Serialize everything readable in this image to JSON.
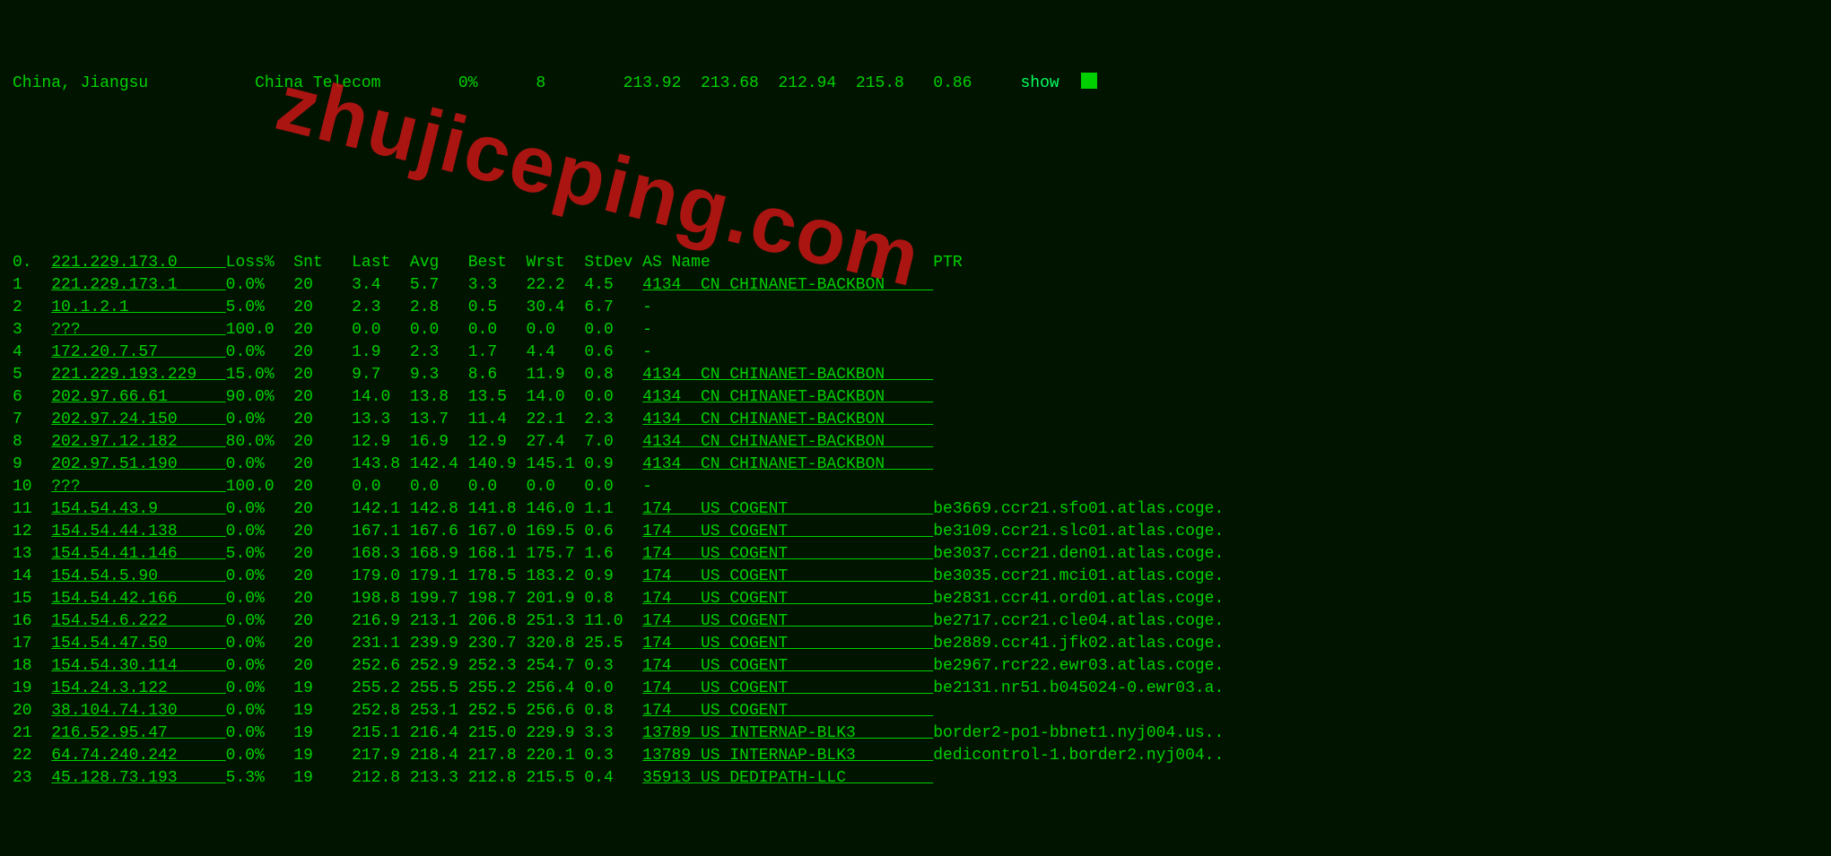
{
  "header": {
    "location": "China, Jiangsu",
    "isp": "China Telecom",
    "loss": "0%",
    "snt": "8",
    "v1": "213.92",
    "v2": "213.68",
    "v3": "212.94",
    "v4": "215.8",
    "v5": "0.86",
    "show": "show"
  },
  "columns": {
    "idx": "0.",
    "host": "221.229.173.0",
    "loss": "Loss%",
    "snt": "Snt",
    "last": "Last",
    "avg": "Avg",
    "best": "Best",
    "wrst": "Wrst",
    "stdev": "StDev",
    "asname": "AS Name",
    "ptr": "PTR"
  },
  "hops": [
    {
      "n": "1",
      "host": "221.229.173.1",
      "loss": "0.0%",
      "snt": "20",
      "last": "3.4",
      "avg": "5.7",
      "best": "3.3",
      "wrst": "22.2",
      "stdev": "4.5",
      "asn": "4134",
      "cc": "CN",
      "asname": "CHINANET-BACKBON",
      "ptr": ""
    },
    {
      "n": "2",
      "host": "10.1.2.1",
      "loss": "5.0%",
      "snt": "20",
      "last": "2.3",
      "avg": "2.8",
      "best": "0.5",
      "wrst": "30.4",
      "stdev": "6.7",
      "asn": "-",
      "cc": "",
      "asname": "",
      "ptr": ""
    },
    {
      "n": "3",
      "host": "???",
      "loss": "100.0",
      "snt": "20",
      "last": "0.0",
      "avg": "0.0",
      "best": "0.0",
      "wrst": "0.0",
      "stdev": "0.0",
      "asn": "-",
      "cc": "",
      "asname": "",
      "ptr": ""
    },
    {
      "n": "4",
      "host": "172.20.7.57",
      "loss": "0.0%",
      "snt": "20",
      "last": "1.9",
      "avg": "2.3",
      "best": "1.7",
      "wrst": "4.4",
      "stdev": "0.6",
      "asn": "-",
      "cc": "",
      "asname": "",
      "ptr": ""
    },
    {
      "n": "5",
      "host": "221.229.193.229",
      "loss": "15.0%",
      "snt": "20",
      "last": "9.7",
      "avg": "9.3",
      "best": "8.6",
      "wrst": "11.9",
      "stdev": "0.8",
      "asn": "4134",
      "cc": "CN",
      "asname": "CHINANET-BACKBON",
      "ptr": ""
    },
    {
      "n": "6",
      "host": "202.97.66.61",
      "loss": "90.0%",
      "snt": "20",
      "last": "14.0",
      "avg": "13.8",
      "best": "13.5",
      "wrst": "14.0",
      "stdev": "0.0",
      "asn": "4134",
      "cc": "CN",
      "asname": "CHINANET-BACKBON",
      "ptr": ""
    },
    {
      "n": "7",
      "host": "202.97.24.150",
      "loss": "0.0%",
      "snt": "20",
      "last": "13.3",
      "avg": "13.7",
      "best": "11.4",
      "wrst": "22.1",
      "stdev": "2.3",
      "asn": "4134",
      "cc": "CN",
      "asname": "CHINANET-BACKBON",
      "ptr": ""
    },
    {
      "n": "8",
      "host": "202.97.12.182",
      "loss": "80.0%",
      "snt": "20",
      "last": "12.9",
      "avg": "16.9",
      "best": "12.9",
      "wrst": "27.4",
      "stdev": "7.0",
      "asn": "4134",
      "cc": "CN",
      "asname": "CHINANET-BACKBON",
      "ptr": ""
    },
    {
      "n": "9",
      "host": "202.97.51.190",
      "loss": "0.0%",
      "snt": "20",
      "last": "143.8",
      "avg": "142.4",
      "best": "140.9",
      "wrst": "145.1",
      "stdev": "0.9",
      "asn": "4134",
      "cc": "CN",
      "asname": "CHINANET-BACKBON",
      "ptr": ""
    },
    {
      "n": "10",
      "host": "???",
      "loss": "100.0",
      "snt": "20",
      "last": "0.0",
      "avg": "0.0",
      "best": "0.0",
      "wrst": "0.0",
      "stdev": "0.0",
      "asn": "-",
      "cc": "",
      "asname": "",
      "ptr": ""
    },
    {
      "n": "11",
      "host": "154.54.43.9",
      "loss": "0.0%",
      "snt": "20",
      "last": "142.1",
      "avg": "142.8",
      "best": "141.8",
      "wrst": "146.0",
      "stdev": "1.1",
      "asn": "174",
      "cc": "US",
      "asname": "COGENT",
      "ptr": "be3669.ccr21.sfo01.atlas.coge."
    },
    {
      "n": "12",
      "host": "154.54.44.138",
      "loss": "0.0%",
      "snt": "20",
      "last": "167.1",
      "avg": "167.6",
      "best": "167.0",
      "wrst": "169.5",
      "stdev": "0.6",
      "asn": "174",
      "cc": "US",
      "asname": "COGENT",
      "ptr": "be3109.ccr21.slc01.atlas.coge."
    },
    {
      "n": "13",
      "host": "154.54.41.146",
      "loss": "5.0%",
      "snt": "20",
      "last": "168.3",
      "avg": "168.9",
      "best": "168.1",
      "wrst": "175.7",
      "stdev": "1.6",
      "asn": "174",
      "cc": "US",
      "asname": "COGENT",
      "ptr": "be3037.ccr21.den01.atlas.coge."
    },
    {
      "n": "14",
      "host": "154.54.5.90",
      "loss": "0.0%",
      "snt": "20",
      "last": "179.0",
      "avg": "179.1",
      "best": "178.5",
      "wrst": "183.2",
      "stdev": "0.9",
      "asn": "174",
      "cc": "US",
      "asname": "COGENT",
      "ptr": "be3035.ccr21.mci01.atlas.coge."
    },
    {
      "n": "15",
      "host": "154.54.42.166",
      "loss": "0.0%",
      "snt": "20",
      "last": "198.8",
      "avg": "199.7",
      "best": "198.7",
      "wrst": "201.9",
      "stdev": "0.8",
      "asn": "174",
      "cc": "US",
      "asname": "COGENT",
      "ptr": "be2831.ccr41.ord01.atlas.coge."
    },
    {
      "n": "16",
      "host": "154.54.6.222",
      "loss": "0.0%",
      "snt": "20",
      "last": "216.9",
      "avg": "213.1",
      "best": "206.8",
      "wrst": "251.3",
      "stdev": "11.0",
      "asn": "174",
      "cc": "US",
      "asname": "COGENT",
      "ptr": "be2717.ccr21.cle04.atlas.coge."
    },
    {
      "n": "17",
      "host": "154.54.47.50",
      "loss": "0.0%",
      "snt": "20",
      "last": "231.1",
      "avg": "239.9",
      "best": "230.7",
      "wrst": "320.8",
      "stdev": "25.5",
      "asn": "174",
      "cc": "US",
      "asname": "COGENT",
      "ptr": "be2889.ccr41.jfk02.atlas.coge."
    },
    {
      "n": "18",
      "host": "154.54.30.114",
      "loss": "0.0%",
      "snt": "20",
      "last": "252.6",
      "avg": "252.9",
      "best": "252.3",
      "wrst": "254.7",
      "stdev": "0.3",
      "asn": "174",
      "cc": "US",
      "asname": "COGENT",
      "ptr": "be2967.rcr22.ewr03.atlas.coge."
    },
    {
      "n": "19",
      "host": "154.24.3.122",
      "loss": "0.0%",
      "snt": "19",
      "last": "255.2",
      "avg": "255.5",
      "best": "255.2",
      "wrst": "256.4",
      "stdev": "0.0",
      "asn": "174",
      "cc": "US",
      "asname": "COGENT",
      "ptr": "be2131.nr51.b045024-0.ewr03.a."
    },
    {
      "n": "20",
      "host": "38.104.74.130",
      "loss": "0.0%",
      "snt": "19",
      "last": "252.8",
      "avg": "253.1",
      "best": "252.5",
      "wrst": "256.6",
      "stdev": "0.8",
      "asn": "174",
      "cc": "US",
      "asname": "COGENT",
      "ptr": ""
    },
    {
      "n": "21",
      "host": "216.52.95.47",
      "loss": "0.0%",
      "snt": "19",
      "last": "215.1",
      "avg": "216.4",
      "best": "215.0",
      "wrst": "229.9",
      "stdev": "3.3",
      "asn": "13789",
      "cc": "US",
      "asname": "INTERNAP-BLK3",
      "ptr": "border2-po1-bbnet1.nyj004.us.."
    },
    {
      "n": "22",
      "host": "64.74.240.242",
      "loss": "0.0%",
      "snt": "19",
      "last": "217.9",
      "avg": "218.4",
      "best": "217.8",
      "wrst": "220.1",
      "stdev": "0.3",
      "asn": "13789",
      "cc": "US",
      "asname": "INTERNAP-BLK3",
      "ptr": "dedicontrol-1.border2.nyj004.."
    },
    {
      "n": "23",
      "host": "45.128.73.193",
      "loss": "5.3%",
      "snt": "19",
      "last": "212.8",
      "avg": "213.3",
      "best": "212.8",
      "wrst": "215.5",
      "stdev": "0.4",
      "asn": "35913",
      "cc": "US",
      "asname": "DEDIPATH-LLC",
      "ptr": ""
    }
  ],
  "watermark": "zhujiceping.com"
}
